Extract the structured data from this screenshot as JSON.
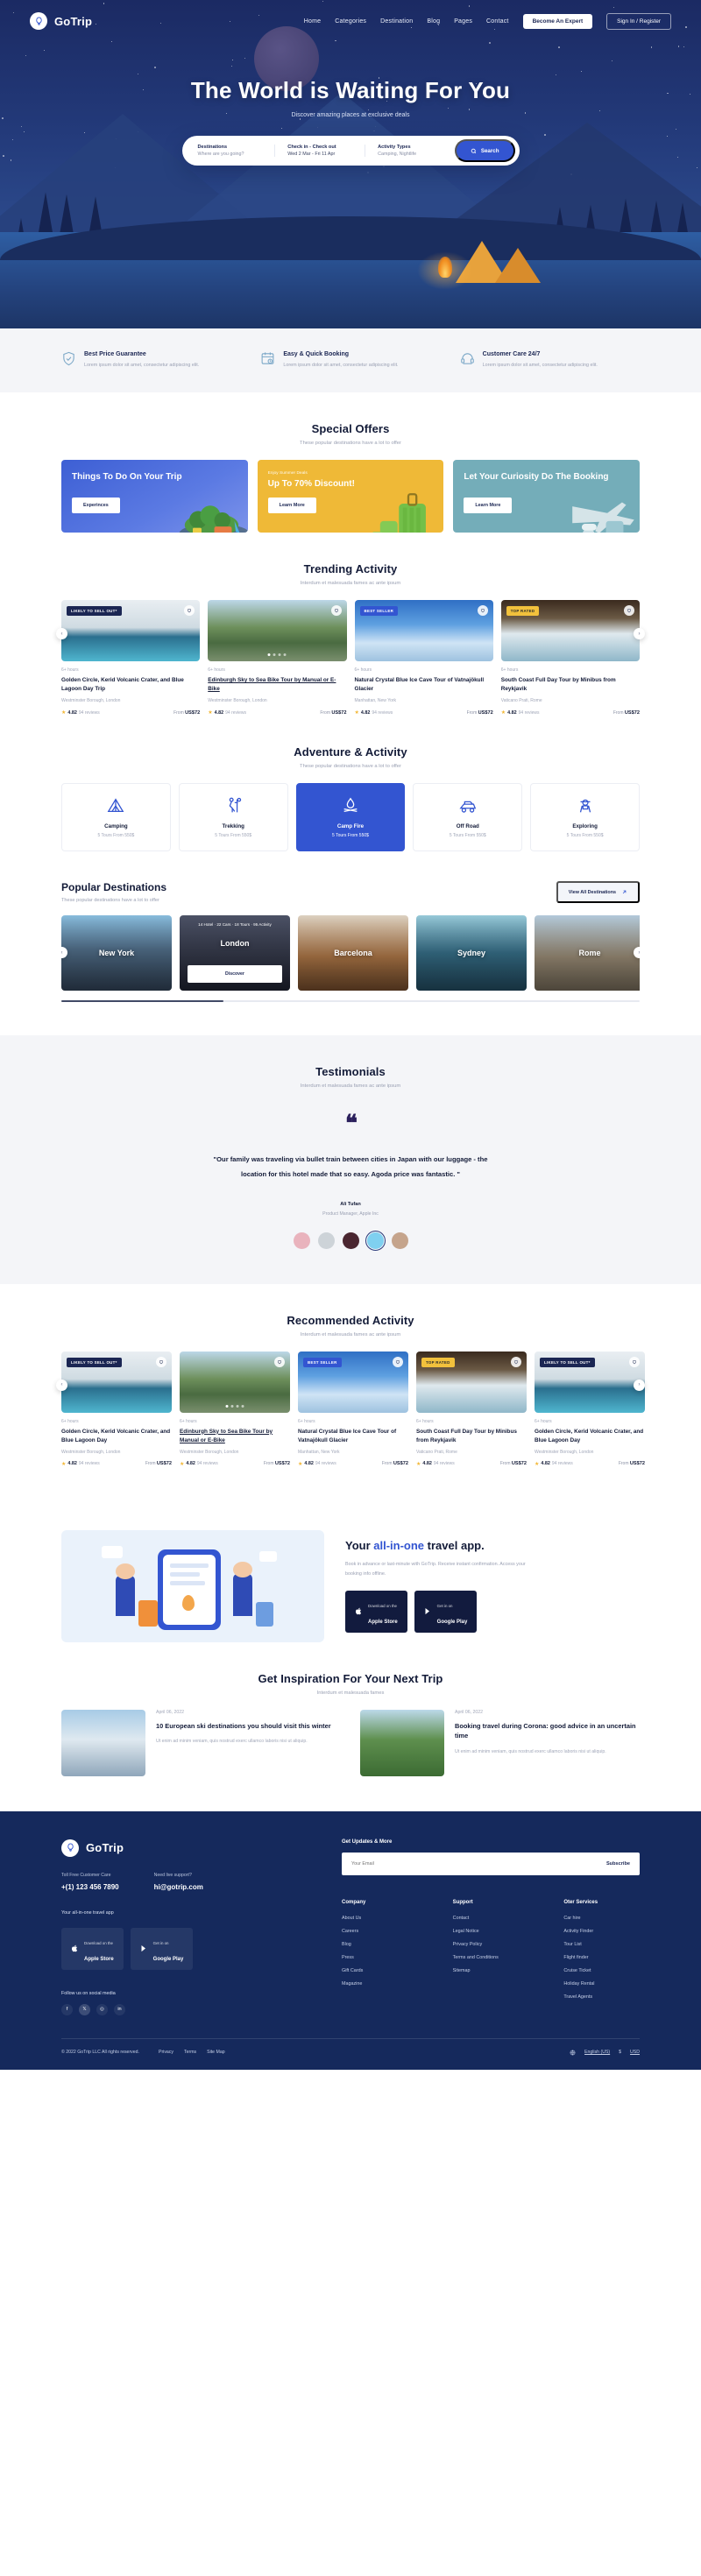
{
  "brand": {
    "name": "GoTrip",
    "icon": "balloon-icon"
  },
  "nav": {
    "links": [
      "Home",
      "Categories",
      "Destination",
      "Blog",
      "Pages",
      "Contact"
    ],
    "expert_button": "Become An Expert",
    "signin_button": "Sign In / Register"
  },
  "hero": {
    "title": "The World is Waiting For You",
    "subtitle": "Discover amazing places at exclusive deals",
    "search": {
      "destination_label": "Destinations",
      "destination_placeholder": "Where are you going?",
      "date_label": "Check in - Check out",
      "date_value": "Wed 2 Mar  -  Fri 11 Apr",
      "activity_label": "Activity Types",
      "activity_value": "Camping, Nightlife",
      "button": "Search"
    }
  },
  "features": [
    {
      "icon": "shield-check-icon",
      "title": "Best Price Guarantee",
      "text": "Lorem ipsum dolor sit amet, consectetur adipiscing elit."
    },
    {
      "icon": "calendar-clock-icon",
      "title": "Easy & Quick Booking",
      "text": "Lorem ipsum dolor sit amet, consectetur adipiscing elit."
    },
    {
      "icon": "support-agent-icon",
      "title": "Customer Care 24/7",
      "text": "Lorem ipsum dolor sit amet, consectetur adipiscing elit."
    }
  ],
  "offers": {
    "title": "Special Offers",
    "subtitle": "These popular destinations have a lot to offer",
    "cards": [
      {
        "kicker": "",
        "title": "Things To Do On Your Trip",
        "button": "Experinces",
        "color": "#4a6ad8"
      },
      {
        "kicker": "Enjoy Summer Deals",
        "title": "Up To 70% Discount!",
        "button": "Learn More",
        "color": "#efb937"
      },
      {
        "kicker": "",
        "title": "Let Your Curiosity Do The Booking",
        "button": "Learn More",
        "color": "#74adb9"
      }
    ]
  },
  "trending": {
    "title": "Trending Activity",
    "subtitle": "Interdum et malesuada fames ac ante ipsum",
    "cards": [
      {
        "badge": "LIKELY TO SELL OUT*",
        "badge_style": "navy",
        "hours": "6+ hours",
        "title": "Golden Circle, Kerid Volcanic Crater, and Blue Lagoon Day Trip",
        "location": "Westminster Borough, London",
        "rating": "4.82",
        "reviews": "94 reviews",
        "price_prefix": "From",
        "price": "US$72"
      },
      {
        "badge": "",
        "badge_style": "",
        "hours": "6+ hours",
        "title": "Edinburgh Sky to Sea Bike Tour by Manual or E-Bike",
        "location": "Westminster Borough, London",
        "rating": "4.82",
        "reviews": "94 reviews",
        "price_prefix": "From",
        "price": "US$72"
      },
      {
        "badge": "BEST SELLER",
        "badge_style": "blue",
        "hours": "6+ hours",
        "title": "Natural Crystal Blue Ice Cave Tour of Vatnajökull Glacier",
        "location": "Manhattan, New York",
        "rating": "4.82",
        "reviews": "94 reviews",
        "price_prefix": "From",
        "price": "US$72"
      },
      {
        "badge": "TOP RATED",
        "badge_style": "yellow",
        "hours": "6+ hours",
        "title": "South Coast Full Day Tour by Minibus from Reykjavik",
        "location": "Vaticano Prati, Rome",
        "rating": "4.82",
        "reviews": "94 reviews",
        "price_prefix": "From",
        "price": "US$72"
      }
    ]
  },
  "adventure": {
    "title": "Adventure & Activity",
    "subtitle": "These popular destinations have a lot to offer",
    "items": [
      {
        "icon": "tent-icon",
        "name": "Camping",
        "sub": "5  Tours From 550$",
        "active": false
      },
      {
        "icon": "trekking-icon",
        "name": "Trekking",
        "sub": "5  Tours From 550$",
        "active": false
      },
      {
        "icon": "campfire-icon",
        "name": "Camp Fire",
        "sub": "5  Tours From 550$",
        "active": true
      },
      {
        "icon": "offroad-icon",
        "name": "Off Road",
        "sub": "5  Tours From 550$",
        "active": false
      },
      {
        "icon": "explorer-icon",
        "name": "Exploring",
        "sub": "5  Tours From 550$",
        "active": false
      }
    ]
  },
  "destinations": {
    "title": "Popular Destinations",
    "subtitle": "These popular destinations have a lot to offer",
    "view_all": "View All Destinations",
    "items": [
      {
        "name": "New York",
        "meta": "",
        "button": "",
        "active": false
      },
      {
        "name": "London",
        "meta": "14 Hotel · 22 Cars · 18 Tours · 95 Activity",
        "button": "Discover",
        "active": true
      },
      {
        "name": "Barcelona",
        "meta": "",
        "button": "",
        "active": false
      },
      {
        "name": "Sydney",
        "meta": "",
        "button": "",
        "active": false
      },
      {
        "name": "Rome",
        "meta": "",
        "button": "",
        "active": false
      }
    ]
  },
  "testimonials": {
    "title": "Testimonials",
    "subtitle": "Interdum et malesuada fames ac ante ipsum",
    "quote_mark": "❝",
    "quote": "\"Our family was traveling via bullet train between cities in Japan with our luggage - the location for this hotel made that so easy. Agoda price was fantastic. \"",
    "author": "Ali Tufan",
    "role": "Product Manager, Apple Inc",
    "avatar_count": 5,
    "active_avatar": 3
  },
  "recommended": {
    "title": "Recommended Activity",
    "subtitle": "Interdum et malesuada fames ac ante ipsum",
    "cards": [
      {
        "badge": "LIKELY TO SELL OUT*",
        "badge_style": "navy",
        "hours": "6+ hours",
        "title": "Golden Circle, Kerid Volcanic Crater, and Blue Lagoon Day",
        "location": "Westminster Borough, London",
        "rating": "4.82",
        "reviews": "94 reviews",
        "price_prefix": "From",
        "price": "US$72"
      },
      {
        "badge": "",
        "badge_style": "",
        "hours": "6+ hours",
        "title": "Edinburgh Sky to Sea Bike Tour by Manual or E-Bike",
        "location": "Westminster Borough, London",
        "rating": "4.82",
        "reviews": "94 reviews",
        "price_prefix": "From",
        "price": "US$72"
      },
      {
        "badge": "BEST SELLER",
        "badge_style": "blue",
        "hours": "6+ hours",
        "title": "Natural Crystal Blue Ice Cave Tour of Vatnajökull Glacier",
        "location": "Manhattan, New York",
        "rating": "4.82",
        "reviews": "94 reviews",
        "price_prefix": "From",
        "price": "US$72"
      },
      {
        "badge": "TOP RATED",
        "badge_style": "yellow",
        "hours": "6+ hours",
        "title": "South Coast Full Day Tour by Minibus from Reykjavik",
        "location": "Vaticano Prati, Rome",
        "rating": "4.82",
        "reviews": "94 reviews",
        "price_prefix": "From",
        "price": "US$72"
      },
      {
        "badge": "LIKELY TO SELL OUT*",
        "badge_style": "navy",
        "hours": "6+ hours",
        "title": "Golden Circle, Kerid Volcanic Crater, and Blue Lagoon Day",
        "location": "Westminster Borough, London",
        "rating": "4.82",
        "reviews": "94 reviews",
        "price_prefix": "From",
        "price": "US$72"
      }
    ]
  },
  "app_promo": {
    "title_pre": "Your ",
    "title_em": "all-in-one",
    "title_post": " travel app.",
    "text": "Book in advance or last-minute with GoTrip. Receive instant confirmation. Access your booking info offline.",
    "stores": [
      {
        "icon": "apple-icon",
        "small": "Download on the",
        "big": "Apple Store"
      },
      {
        "icon": "google-play-icon",
        "small": "Get in on",
        "big": "Google Play"
      }
    ]
  },
  "blog": {
    "title": "Get Inspiration For Your Next Trip",
    "subtitle": "Interdum et malesuada fames",
    "posts": [
      {
        "date": "April 06, 2022",
        "title": "10 European ski destinations you should visit this winter",
        "excerpt": "Ut enim ad minim veniam, quis nostrud exerc ullamco laboris nisi ut aliquip."
      },
      {
        "date": "April 06, 2022",
        "title": "Booking travel during Corona: good advice in an uncertain time",
        "excerpt": "Ut enim ad minim veniam, quis nostrud exerc ullamco laboris nisi ut aliquip."
      }
    ]
  },
  "footer": {
    "brand": "GoTrip",
    "care_label": "Toll Free Customer Care",
    "care_value": "+(1) 123 456 7890",
    "support_label": "Need live support?",
    "support_value": "hi@gotrip.com",
    "app_label": "Your all-in-one travel app",
    "stores": [
      {
        "icon": "apple-icon",
        "small": "Download on the",
        "big": "Apple Store"
      },
      {
        "icon": "google-play-icon",
        "small": "Get in on",
        "big": "Google Play"
      }
    ],
    "social_label": "Follow us on social media",
    "socials": [
      "facebook-icon",
      "twitter-icon",
      "instagram-icon",
      "linkedin-icon"
    ],
    "newsletter_label": "Get Updates & More",
    "newsletter_placeholder": "Your Email",
    "subscribe": "Subscribe",
    "columns": [
      {
        "title": "Company",
        "links": [
          "About Us",
          "Careers",
          "Blog",
          "Press",
          "Gift Cards",
          "Magazine"
        ]
      },
      {
        "title": "Support",
        "links": [
          "Contact",
          "Legal Notice",
          "Privacy Policy",
          "Terms and Conditions",
          "Sitemap"
        ]
      },
      {
        "title": "Oter Services",
        "links": [
          "Car hire",
          "Activity Finder",
          "Tour List",
          "Flight finder",
          "Cruise Ticket",
          "Holiday Rental",
          "Travel Agents"
        ]
      }
    ],
    "copyright": "© 2022 GoTrip LLC All rights reserved.",
    "bottom_links": [
      "Privacy",
      "Terms",
      "Site Map"
    ],
    "language": "English (US)",
    "currency": "USD"
  }
}
